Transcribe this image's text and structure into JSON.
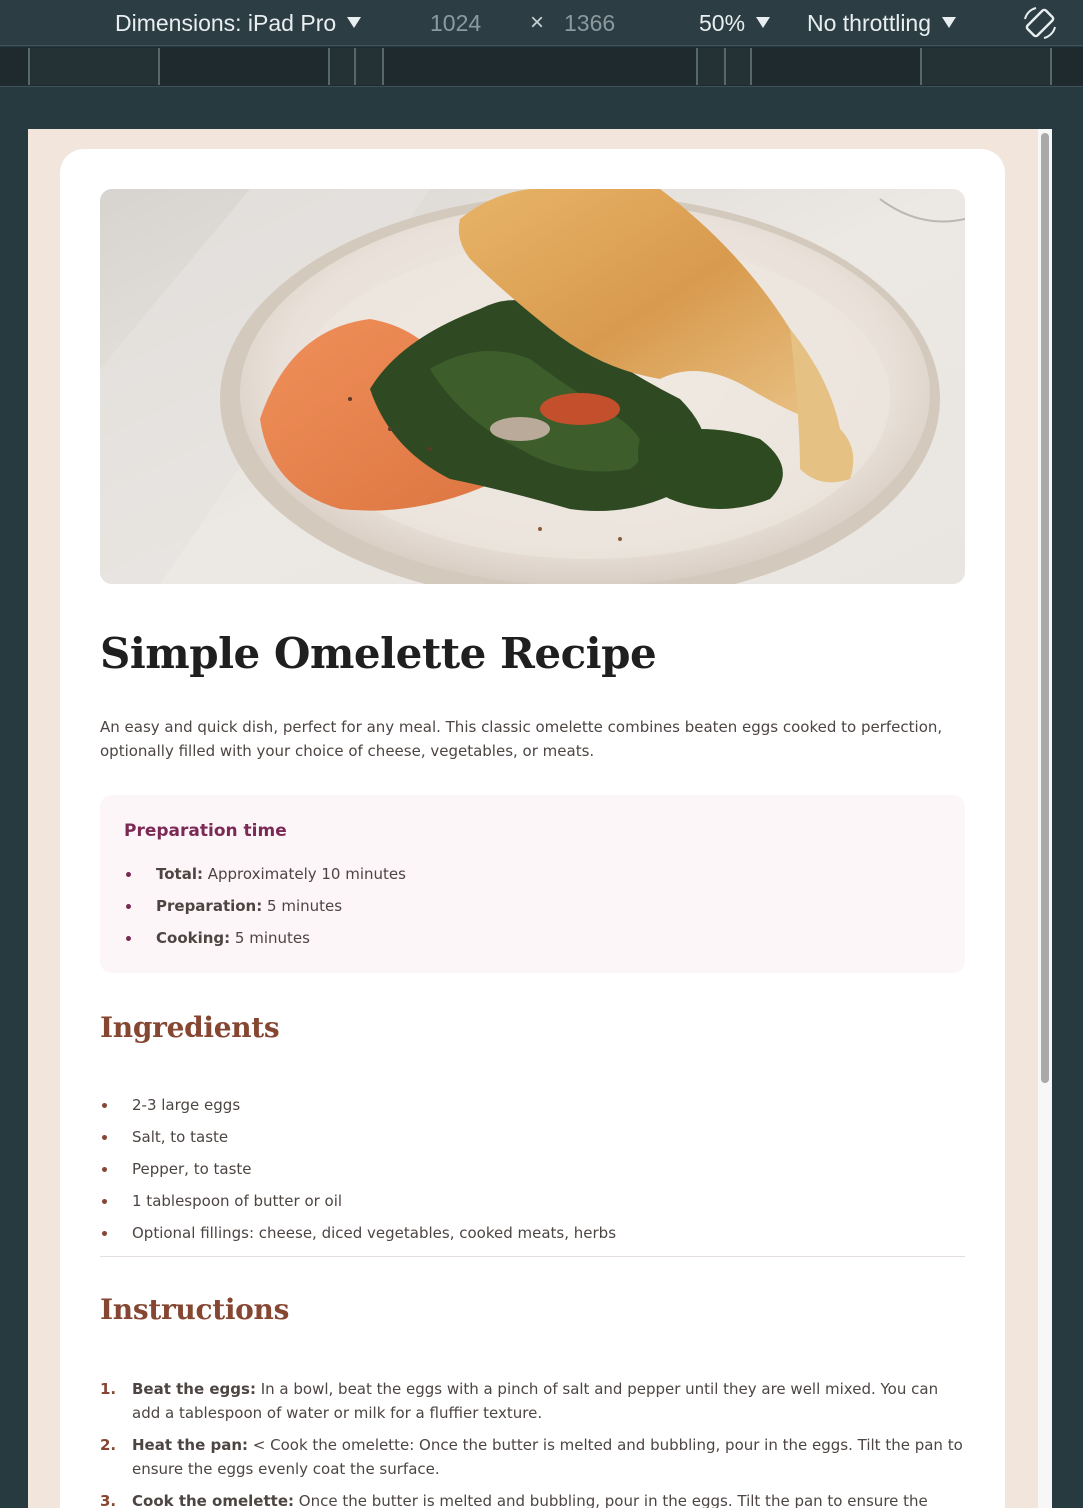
{
  "devtools": {
    "dimensions_label": "Dimensions: iPad Pro",
    "width_value": "1024",
    "times_glyph": "×",
    "height_value": "1366",
    "zoom": "50%",
    "throttling": "No throttling",
    "rotate_icon": "rotate-device-icon"
  },
  "recipe": {
    "hero_image": "omelette-plate-photo",
    "title": "Simple Omelette Recipe",
    "description": "An easy and quick dish, perfect for any meal. This classic omelette combines beaten eggs cooked to perfection, optionally filled with your choice of cheese, vegetables, or meats.",
    "prep": {
      "title": "Preparation time",
      "items": [
        {
          "label": "Total:",
          "value": " Approximately 10 minutes"
        },
        {
          "label": "Preparation:",
          "value": " 5 minutes"
        },
        {
          "label": "Cooking:",
          "value": " 5 minutes"
        }
      ]
    },
    "ingredients": {
      "title": "Ingredients",
      "items": [
        "2-3 large eggs",
        "Salt, to taste",
        "Pepper, to taste",
        "1 tablespoon of butter or oil",
        "Optional fillings: cheese, diced vegetables, cooked meats, herbs"
      ]
    },
    "instructions": {
      "title": "Instructions",
      "items": [
        {
          "num": "1.",
          "label": "Beat the eggs:",
          "text": " In a bowl, beat the eggs with a pinch of salt and pepper until they are well mixed. You can add a tablespoon of water or milk for a fluffier texture."
        },
        {
          "num": "2.",
          "label": "Heat the pan:",
          "text": " < Cook the omelette: Once the butter is melted and bubbling, pour in the eggs. Tilt the pan to ensure the eggs evenly coat the surface."
        },
        {
          "num": "3.",
          "label": "Cook the omelette:",
          "text": " Once the butter is melted and bubbling, pour in the eggs. Tilt the pan to ensure the eggs evenly"
        }
      ]
    }
  },
  "colors": {
    "page_bg": "#f2e5dc",
    "heading_brown": "#854632",
    "prep_accent": "#7a2a54",
    "prep_bg": "#fdf6f9",
    "devtools_bg": "#2c3e44"
  }
}
